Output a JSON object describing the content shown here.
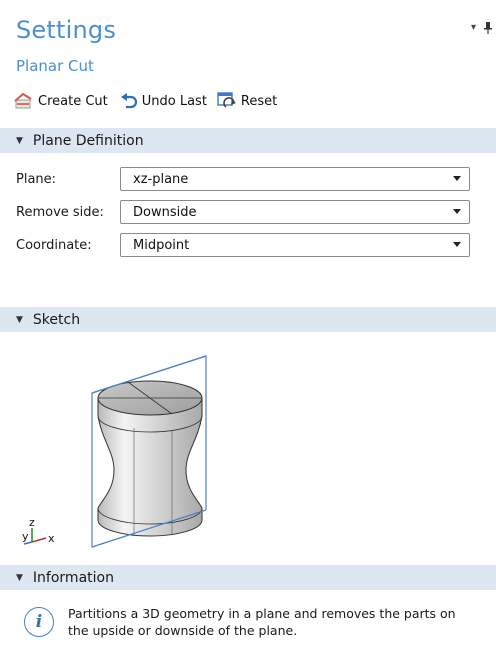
{
  "header": {
    "title": "Settings",
    "subtitle": "Planar Cut",
    "dropdown_glyph": "▾",
    "pin_glyph": "📌"
  },
  "toolbar": {
    "create_cut_label": "Create Cut",
    "undo_last_label": "Undo Last",
    "reset_label": "Reset"
  },
  "sections": {
    "plane_definition": "Plane Definition",
    "sketch": "Sketch",
    "information": "Information"
  },
  "plane_definition": {
    "plane_label": "Plane:",
    "plane_value": "xz-plane",
    "remove_side_label": "Remove side:",
    "remove_side_value": "Downside",
    "coordinate_label": "Coordinate:",
    "coordinate_value": "Midpoint"
  },
  "sketch": {
    "axis_y": "y",
    "axis_z": "z",
    "axis_x": "x"
  },
  "information": {
    "text": "Partitions a 3D geometry in a plane and removes the parts on the upside or downside of the plane."
  },
  "colors": {
    "accent": "#4a8fcf",
    "section_bg": "#dce7f1",
    "plane_line": "#4f7fc4"
  }
}
